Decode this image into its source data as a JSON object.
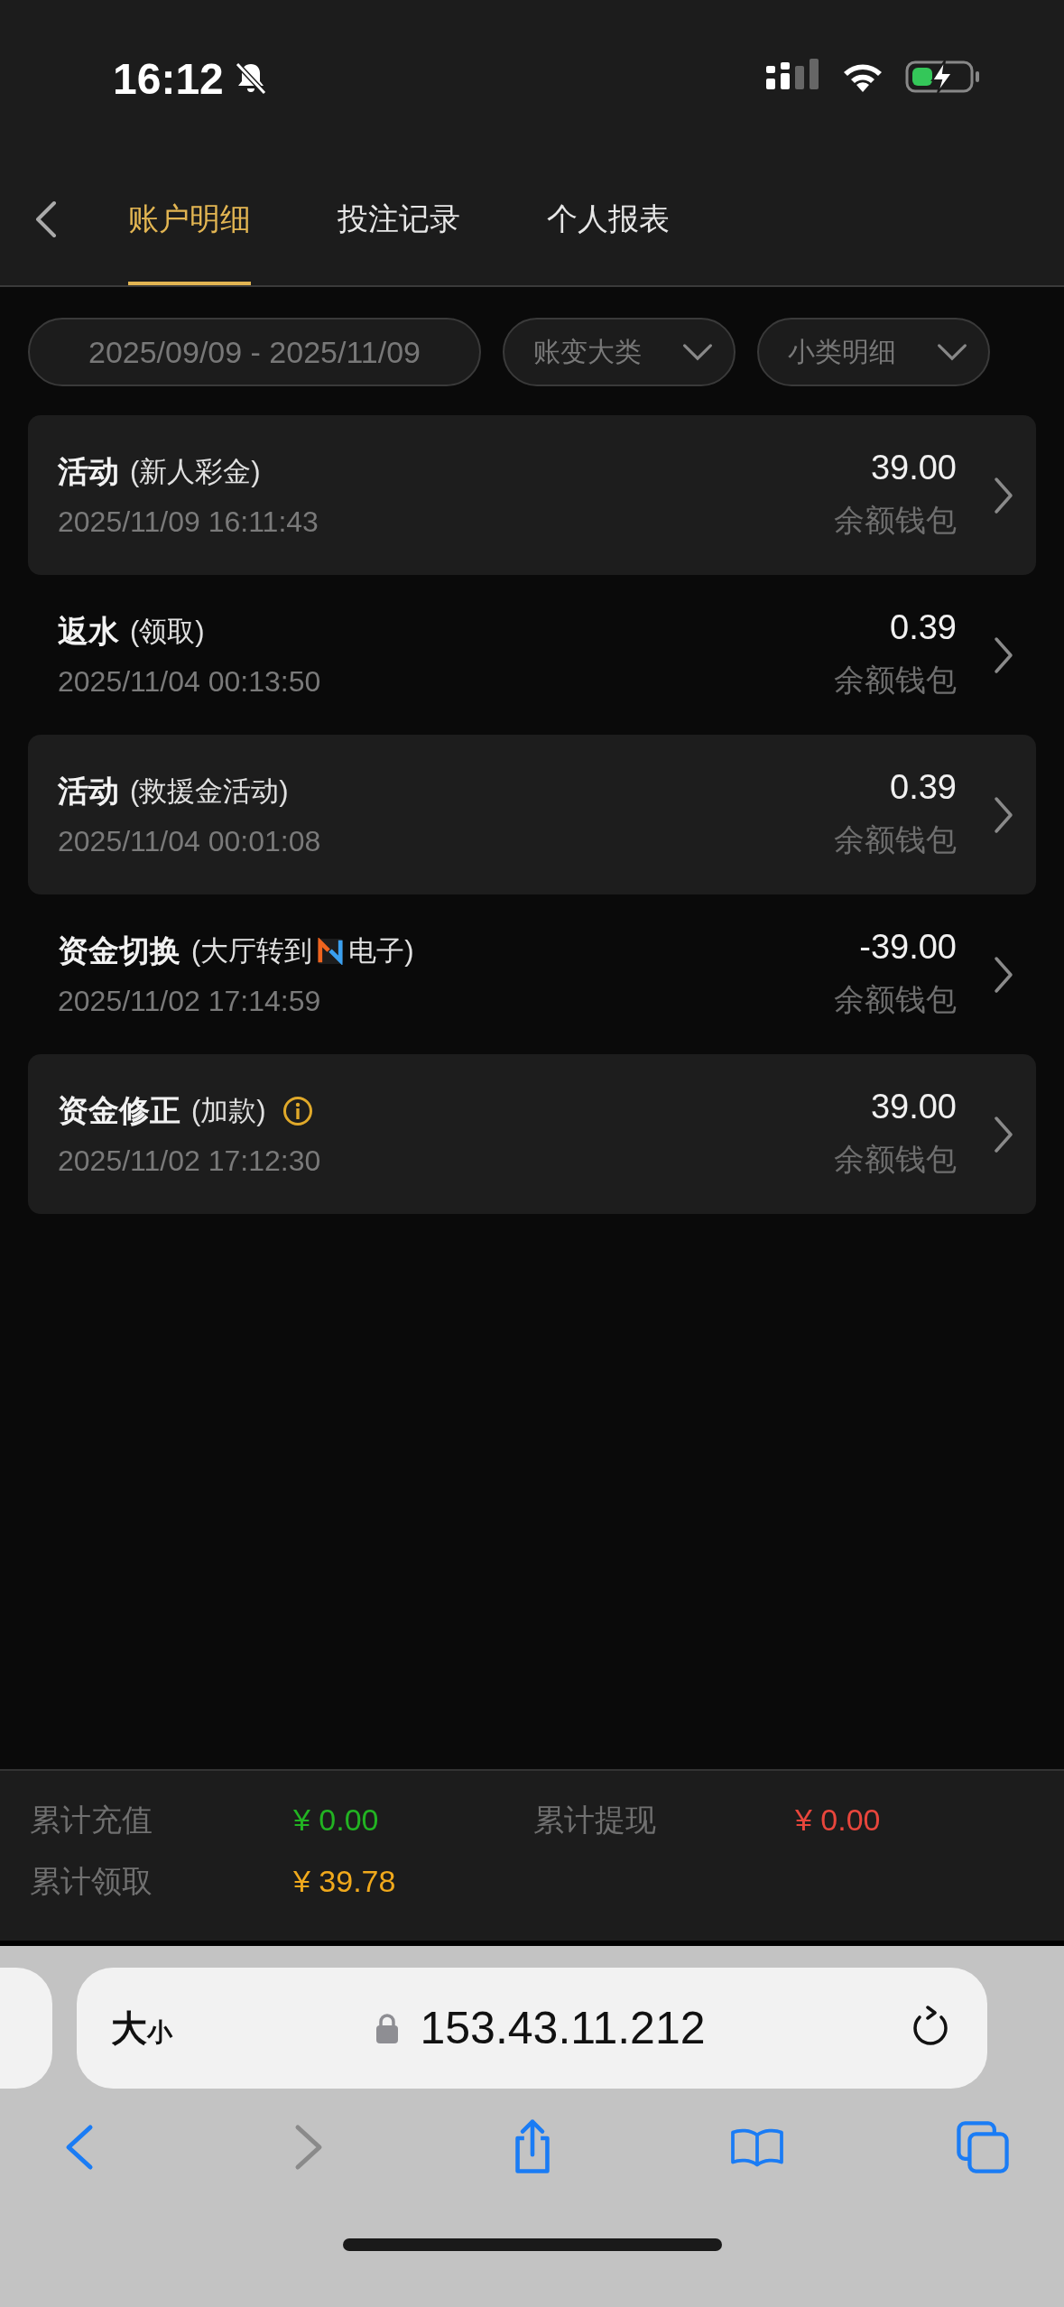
{
  "status_bar": {
    "time": "16:12"
  },
  "tabs": [
    {
      "label": "账户明细",
      "selected": true
    },
    {
      "label": "投注记录",
      "selected": false
    },
    {
      "label": "个人报表",
      "selected": false
    }
  ],
  "filters": {
    "date_range": "2025/09/09 - 2025/11/09",
    "category": "账变大类",
    "subcategory": "小类明细"
  },
  "records": [
    {
      "title": "活动",
      "detail": [
        "(新人彩金)"
      ],
      "info": false,
      "time": "2025/11/09 16:11:43",
      "amount": "39.00",
      "wallet": "余额钱包"
    },
    {
      "title": "返水",
      "detail": [
        "(领取)"
      ],
      "info": false,
      "time": "2025/11/04 00:13:50",
      "amount": "0.39",
      "wallet": "余额钱包"
    },
    {
      "title": "活动",
      "detail": [
        "(救援金活动)"
      ],
      "info": false,
      "time": "2025/11/04 00:01:08",
      "amount": "0.39",
      "wallet": "余额钱包"
    },
    {
      "title": "资金切换",
      "detail": [
        "(大厅转到",
        "电子)"
      ],
      "info": false,
      "time": "2025/11/02 17:14:59",
      "amount": "-39.00",
      "wallet": "余额钱包"
    },
    {
      "title": "资金修正",
      "detail": [
        "(加款)"
      ],
      "info": true,
      "time": "2025/11/02 17:12:30",
      "amount": "39.00",
      "wallet": "余额钱包"
    }
  ],
  "summary": [
    {
      "label": "累计充值",
      "value": "¥ 0.00",
      "color": "#22b322"
    },
    {
      "label": "累计提现",
      "value": "¥ 0.00",
      "color": "#e8463c"
    },
    {
      "label": "累计领取",
      "value": "¥ 39.78",
      "color": "#f0a91c"
    }
  ],
  "browser": {
    "format_large": "大",
    "format_small": "小",
    "url": "153.43.11.212"
  }
}
